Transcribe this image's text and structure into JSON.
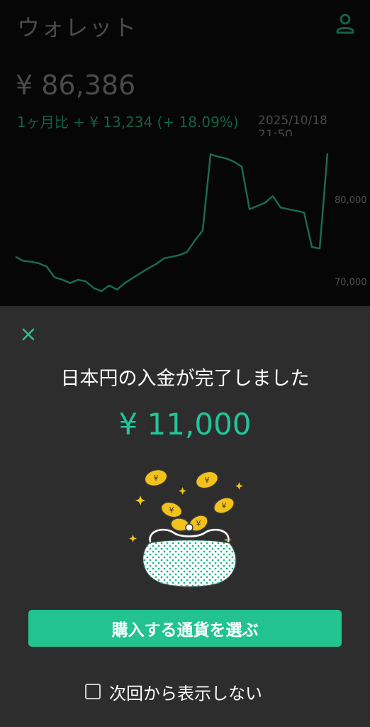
{
  "wallet": {
    "title": "ウォレット",
    "balance": "¥ 86,386",
    "change": "1ヶ月比 + ¥ 13,234 (+ 18.09%)",
    "timestamp": "2025/10/18 21:50",
    "account_icon": "person-icon"
  },
  "chart_data": {
    "type": "line",
    "y_tick_labels": [
      "80,000",
      "70,000"
    ],
    "y_ticks": [
      80000,
      70000
    ],
    "ylim": [
      67000,
      87000
    ],
    "grid": false,
    "series": [
      {
        "color": "#1a6a52",
        "values": [
          73000,
          72500,
          72400,
          72200,
          71800,
          70500,
          70200,
          69800,
          70200,
          70000,
          69200,
          68800,
          69500,
          69000,
          69800,
          70400,
          71000,
          71600,
          72100,
          72800,
          73000,
          73200,
          73600,
          75000,
          76200,
          85500,
          85200,
          85000,
          84600,
          84000,
          78800,
          79200,
          79600,
          80400,
          79000,
          78800,
          78600,
          78400,
          74200,
          74000,
          85600
        ]
      }
    ]
  },
  "dialog": {
    "close_icon": "close-icon",
    "title": "日本円の入金が完了しました",
    "amount": "¥ 11,000",
    "illustration": "coin-purse-illustration",
    "primary_button": "購入する通貨を選ぶ",
    "dont_show_again": "次回から表示しない",
    "dont_show_checked": false
  },
  "colors": {
    "accent": "#22c38f",
    "amount_text": "#22c59a",
    "sheet_bg": "#2d2d2d",
    "coin_gold": "#f2c21b"
  }
}
